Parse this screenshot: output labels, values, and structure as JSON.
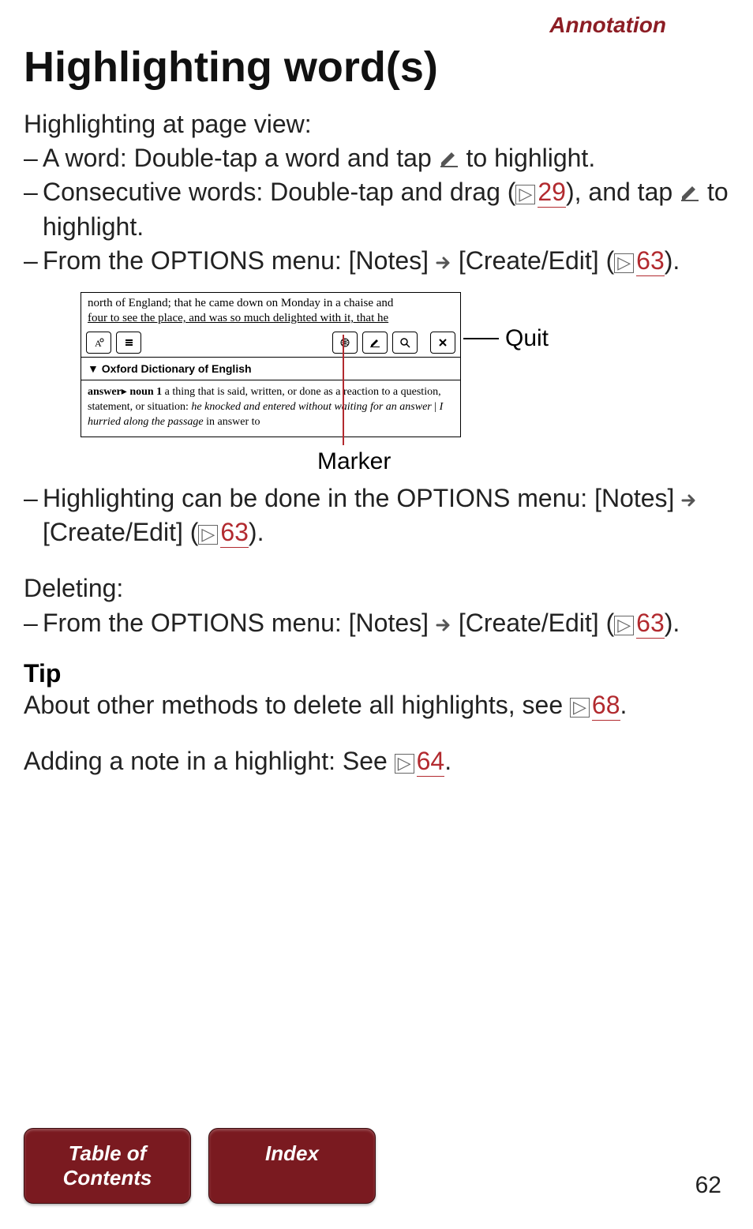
{
  "header": {
    "section": "Annotation"
  },
  "title": "Highlighting word(s)",
  "intro": "Highlighting at page view:",
  "bullets1": {
    "b1a": "A word: Double-tap a word and tap ",
    "b1b": " to highlight.",
    "b2a": "Consecutive words: Double-tap and drag (",
    "b2_page": "29",
    "b2b": "), and tap ",
    "b2c": " to highlight.",
    "b3a": "From the OPTIONS menu: [Notes] ",
    "b3b": " [Create/Edit] (",
    "b3_page": "63",
    "b3c": ")."
  },
  "figure": {
    "reader_text_line1": "north of England; that he came down on Monday in a chaise and",
    "reader_text_line2": "four to see the place, and was so much delighted with it, that he",
    "dict_title": "Oxford Dictionary of English",
    "def_word": "answer",
    "def_pos": " noun ",
    "def_num": "1",
    "def_body1": " a thing that is said, written, or done as a reaction to a question, statement, or situation: ",
    "def_ex1": "he knocked and entered without waiting for an answer",
    "def_sep": "  |  ",
    "def_ex2": "I hurried along the passage",
    "def_tail": " in answer to",
    "callout_quit": "Quit",
    "callout_marker": "Marker"
  },
  "bullets2": {
    "b4a": "Highlighting can be done in the OPTIONS menu: [Notes] ",
    "b4b": " [Create/Edit] (",
    "b4_page": "63",
    "b4c": ")."
  },
  "deleting_heading": "Deleting:",
  "bullets3": {
    "b5a": "From the OPTIONS menu: [Notes] ",
    "b5b": " [Create/Edit] (",
    "b5_page": "63",
    "b5c": ")."
  },
  "tip_label": "Tip",
  "tip_text_a": "About other methods to delete all highlights, see ",
  "tip_page": "68",
  "tip_text_b": ".",
  "addnote_a": "Adding a note in a highlight: See ",
  "addnote_page": "64",
  "addnote_b": ".",
  "nav": {
    "toc": "Table of Contents",
    "index": "Index"
  },
  "page_number": "62",
  "glyphs": {
    "page_ref": "▷"
  }
}
